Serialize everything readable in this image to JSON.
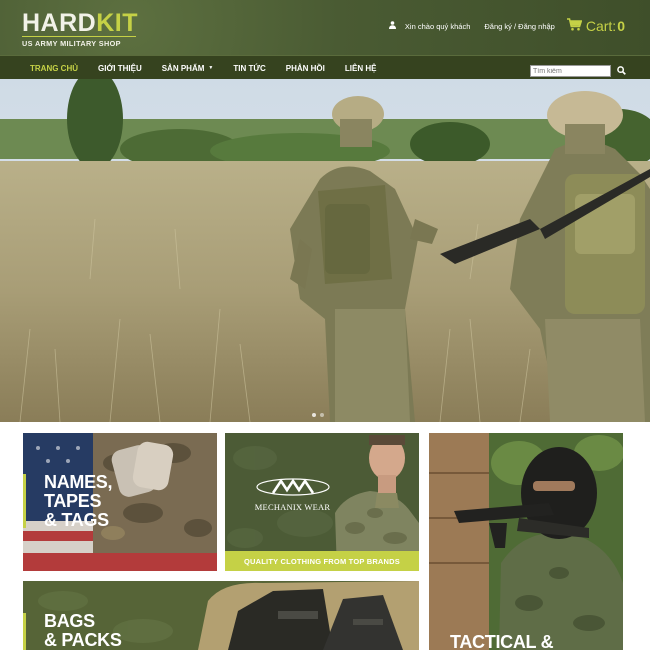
{
  "brand": {
    "logo_main_a": "HARD",
    "logo_main_b": "KIT",
    "tagline": "US ARMY MILITARY SHOP"
  },
  "header": {
    "greeting": "Xin chào quý khách",
    "auth_link": "Đăng ký / Đăng nhập",
    "cart_label": "Cart:",
    "cart_count": "0"
  },
  "nav": {
    "items": [
      {
        "label": "TRANG CHỦ",
        "active": true
      },
      {
        "label": "GIỚI THIỆU"
      },
      {
        "label": "SẢN PHẨM",
        "has_dropdown": true
      },
      {
        "label": "TIN TỨC"
      },
      {
        "label": "PHẢN HỒI"
      },
      {
        "label": "LIÊN HỆ"
      }
    ],
    "search_placeholder": "Tìm kiếm"
  },
  "tiles": {
    "names_tapes_tags": {
      "title": "NAMES,\nTAPES\n& TAGS"
    },
    "mechanix": {
      "brand": "MECHANIX WEAR",
      "caption": "QUALITY CLOTHING FROM TOP BRANDS"
    },
    "bags_packs": {
      "title": "BAGS\n& PACKS"
    },
    "tactical": {
      "title": "TACTICAL &"
    }
  },
  "colors": {
    "accent": "#c5d146",
    "header_bg": "#4a5b33",
    "nav_bg": "#36431f"
  },
  "icons": [
    "user-icon",
    "cart-icon",
    "search-icon"
  ]
}
